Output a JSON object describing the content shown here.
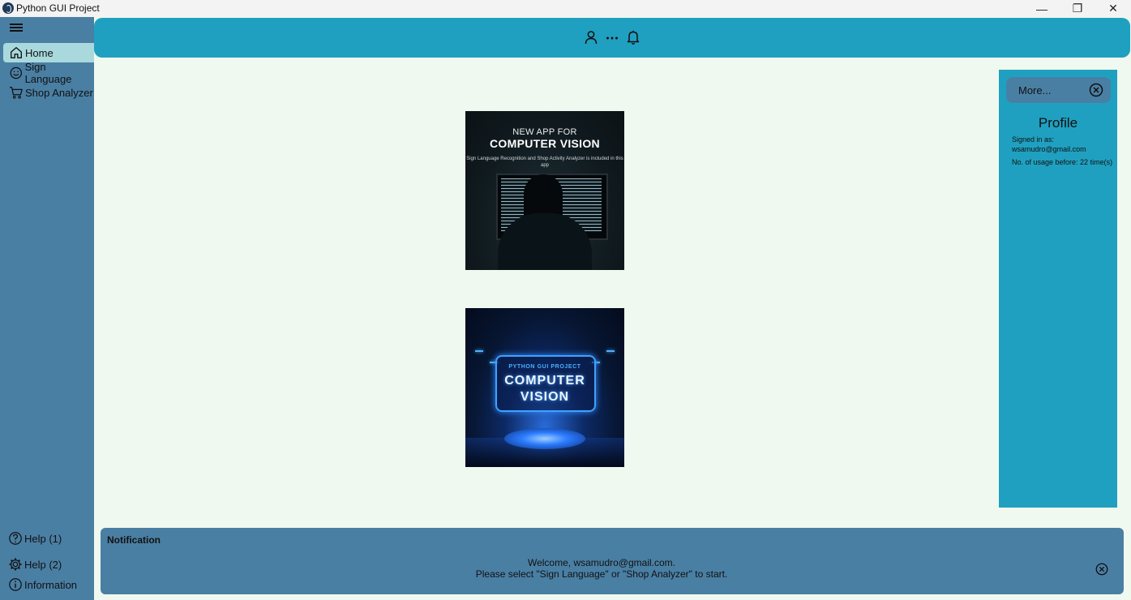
{
  "window": {
    "title": "Python GUI Project",
    "controls": {
      "minimize": "—",
      "restore": "❐",
      "close": "✕"
    }
  },
  "sidebar": {
    "items": [
      {
        "label": "Home",
        "icon": "home-icon",
        "active": true
      },
      {
        "label": "Sign Language",
        "icon": "smile-icon",
        "active": false
      },
      {
        "label": "Shop Analyzer",
        "icon": "cart-icon",
        "active": false
      }
    ],
    "footer": [
      {
        "label": "Help (1)",
        "icon": "question-icon"
      },
      {
        "label": "Help (2)",
        "icon": "gear-icon"
      },
      {
        "label": "Information",
        "icon": "info-icon"
      }
    ]
  },
  "topbar": {
    "icons": [
      "user-icon",
      "more-icon",
      "bell-icon"
    ]
  },
  "banners": [
    {
      "line1": "NEW APP FOR",
      "line2": "COMPUTER VISION",
      "line3": "Sign Language Recognition and Shop Activity Analyzer is included in this app"
    },
    {
      "line1": "PYTHON GUI PROJECT",
      "line2": "COMPUTER",
      "line3": "VISION"
    }
  ],
  "profile": {
    "more_label": "More...",
    "title": "Profile",
    "signed_in_label": "Signed in as:",
    "email": "wsamudro@gmail.com",
    "usage": "No. of usage before: 22 time(s)"
  },
  "notification": {
    "title": "Notification",
    "line1": "Welcome, wsamudro@gmail.com.",
    "line2": "Please select \"Sign Language\" or \"Shop Analyzer\" to start."
  },
  "colors": {
    "sidebar": "#4a7fa4",
    "accent": "#20a0c0",
    "active_item": "#a9d9dc",
    "background": "#f0f9ef"
  }
}
